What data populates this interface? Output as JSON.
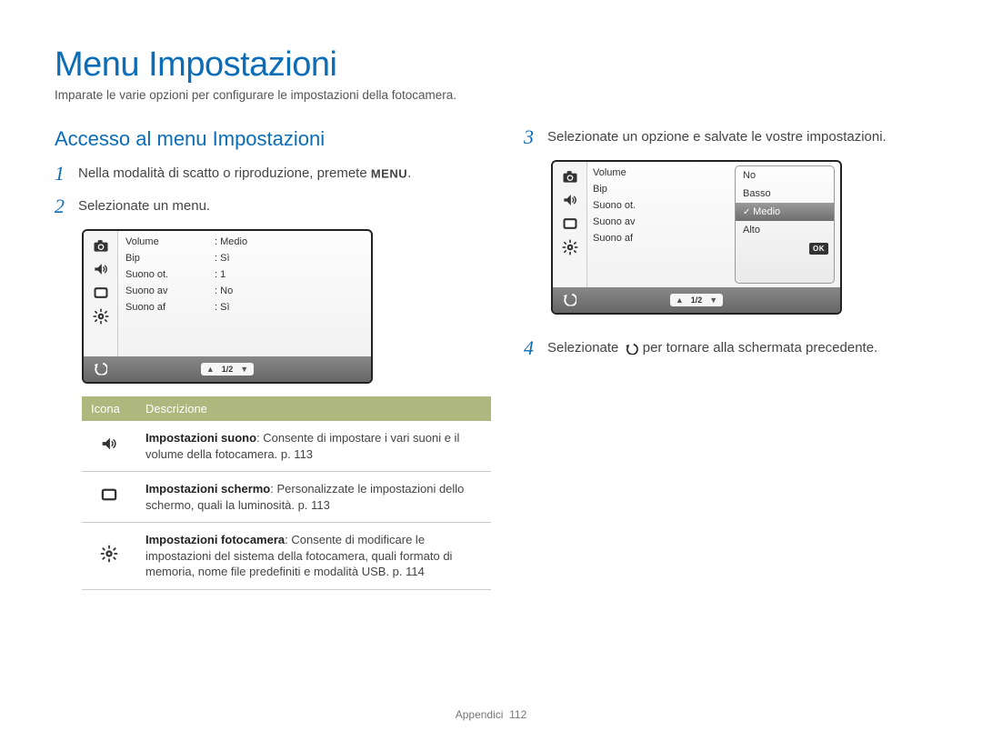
{
  "title": "Menu Impostazioni",
  "subtitle": "Imparate le varie opzioni per configurare le impostazioni della fotocamera.",
  "section_heading": "Accesso al menu Impostazioni",
  "steps": {
    "s1_num": "1",
    "s1_text_a": "Nella modalità di scatto o riproduzione, premete ",
    "s1_text_b": ".",
    "s1_menu_label": "MENU",
    "s2_num": "2",
    "s2_text": "Selezionate un menu.",
    "s3_num": "3",
    "s3_text": "Selezionate un opzione e salvate le vostre impostazioni.",
    "s4_num": "4",
    "s4_text_a": "Selezionate ",
    "s4_text_b": " per tornare alla schermata precedente."
  },
  "screen1": {
    "rows": [
      {
        "label": "Volume",
        "value": "Medio"
      },
      {
        "label": "Bip",
        "value": "Sì"
      },
      {
        "label": "Suono ot.",
        "value": "1"
      },
      {
        "label": "Suono av",
        "value": "No"
      },
      {
        "label": "Suono af",
        "value": "Sì"
      }
    ],
    "page": "1/2"
  },
  "screen2": {
    "rows": [
      {
        "label": "Volume"
      },
      {
        "label": "Bip"
      },
      {
        "label": "Suono ot."
      },
      {
        "label": "Suono av"
      },
      {
        "label": "Suono af"
      }
    ],
    "options": [
      {
        "label": "No"
      },
      {
        "label": "Basso"
      },
      {
        "label": "Medio",
        "selected": true
      },
      {
        "label": "Alto"
      }
    ],
    "ok": "OK",
    "page": "1/2"
  },
  "table": {
    "head_icon": "Icona",
    "head_desc": "Descrizione",
    "rows": [
      {
        "title": "Impostazioni suono",
        "body": ": Consente di impostare i vari suoni e il volume della fotocamera. p. 113"
      },
      {
        "title": "Impostazioni schermo",
        "body": ": Personalizzate le impostazioni dello schermo, quali la luminosità. p. 113"
      },
      {
        "title": "Impostazioni fotocamera",
        "body": ": Consente di modificare le impostazioni del sistema della fotocamera, quali formato di memoria, nome file predefiniti e modalità USB. p. 114"
      }
    ]
  },
  "footer": {
    "label": "Appendici",
    "page": "112"
  }
}
